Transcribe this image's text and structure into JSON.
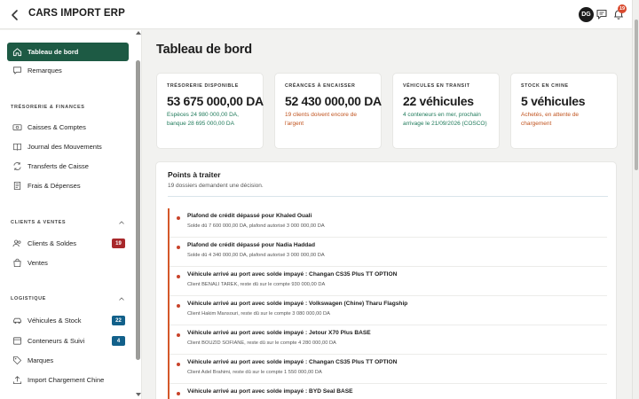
{
  "app": {
    "title": "CARS IMPORT ERP"
  },
  "header": {
    "avatar_initials": "DG",
    "notification_count": "19"
  },
  "sidebar": {
    "top_items": [
      {
        "label": "Tableau de bord",
        "icon": "home-icon"
      },
      {
        "label": "Remarques",
        "icon": "comment-icon"
      }
    ],
    "sections": [
      {
        "title": "TRÉSORERIE & FINANCES",
        "items": [
          {
            "label": "Caisses & Comptes",
            "icon": "cash-icon"
          },
          {
            "label": "Journal des Mouvements",
            "icon": "journal-icon"
          },
          {
            "label": "Transferts de Caisse",
            "icon": "transfer-icon"
          },
          {
            "label": "Frais & Dépenses",
            "icon": "receipt-icon"
          }
        ]
      },
      {
        "title": "CLIENTS & VENTES",
        "items": [
          {
            "label": "Clients & Soldes",
            "icon": "users-icon",
            "badge": "19"
          },
          {
            "label": "Ventes",
            "icon": "bag-icon"
          }
        ]
      },
      {
        "title": "LOGISTIQUE",
        "items": [
          {
            "label": "Véhicules & Stock",
            "icon": "car-icon",
            "badge": "22"
          },
          {
            "label": "Conteneurs & Suivi",
            "icon": "container-icon",
            "badge": "4"
          },
          {
            "label": "Marques",
            "icon": "tag-icon"
          },
          {
            "label": "Import Chargement Chine",
            "icon": "upload-icon"
          }
        ]
      }
    ]
  },
  "main": {
    "title": "Tableau de bord",
    "kpis": [
      {
        "label": "TRÉSORERIE DISPONIBLE",
        "value": "53 675 000,00 DA",
        "note": "Espèces 24 980 000,00 DA, banque 28 695 000,00 DA",
        "tone": "green"
      },
      {
        "label": "CRÉANCES À ENCAISSER",
        "value": "52 430 000,00 DA",
        "note": "19 clients doivent encore de l'argent",
        "tone": "orange"
      },
      {
        "label": "VÉHICULES EN TRANSIT",
        "value": "22 véhicules",
        "note": "4 conteneurs en mer, prochain arrivage le 21/09/2026 (COSCO)",
        "tone": "green"
      },
      {
        "label": "STOCK EN CHINE",
        "value": "5 véhicules",
        "note": "Achetés, en attente de chargement",
        "tone": "orange"
      }
    ],
    "panel": {
      "title": "Points à traiter",
      "subtitle": "19 dossiers demandent une décision.",
      "items": [
        {
          "title": "Plafond de crédit dépassé pour Khaled Ouali",
          "detail": "Solde dû 7 600 000,00 DA, plafond autorisé 3 000 000,00 DA"
        },
        {
          "title": "Plafond de crédit dépassé pour Nadia Haddad",
          "detail": "Solde dû 4 340 000,00 DA, plafond autorisé 3 000 000,00 DA"
        },
        {
          "title": "Véhicule arrivé au port avec solde impayé : Changan CS35 Plus TT OPTION",
          "detail": "Client BENALI TAREK, reste dû sur le compte 930 000,00 DA"
        },
        {
          "title": "Véhicule arrivé au port avec solde impayé : Volkswagen (Chine) Tharu Flagship",
          "detail": "Client Hakim Mansouri, reste dû sur le compte 3 080 000,00 DA"
        },
        {
          "title": "Véhicule arrivé au port avec solde impayé : Jetour X70 Plus BASE",
          "detail": "Client BOUZID SOFIANE, reste dû sur le compte 4 280 000,00 DA"
        },
        {
          "title": "Véhicule arrivé au port avec solde impayé : Changan CS35 Plus TT OPTION",
          "detail": "Client Adel Brahimi, reste dû sur le compte 1 550 000,00 DA"
        },
        {
          "title": "Véhicule arrivé au port avec solde impayé : BYD Seal BASE",
          "detail": ""
        }
      ]
    }
  },
  "colors": {
    "accent": "#1d5a44",
    "danger": "#a8282b",
    "info": "#12608a",
    "warning": "#c0531e"
  }
}
